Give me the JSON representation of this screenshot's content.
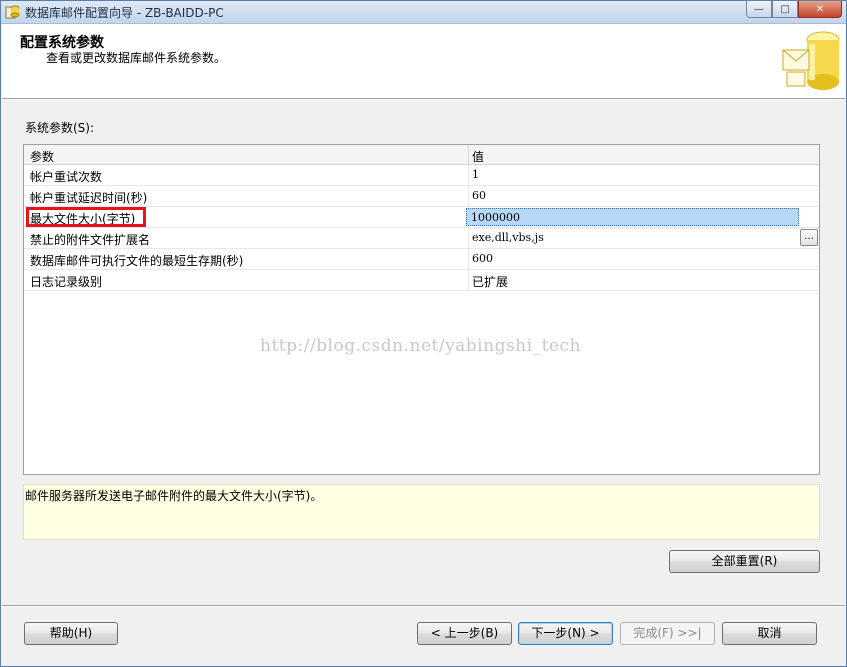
{
  "window": {
    "title": "数据库邮件配置向导 - ZB-BAIDD-PC",
    "min_glyph": "—",
    "max_glyph": "□",
    "close_glyph": "✕"
  },
  "header": {
    "title": "配置系统参数",
    "subtitle": "查看或更改数据库邮件系统参数。"
  },
  "section_label": "系统参数(S):",
  "grid": {
    "col_param": "参数",
    "col_value": "值",
    "rows": [
      {
        "param": "帐户重试次数",
        "value": "1"
      },
      {
        "param": "帐户重试延迟时间(秒)",
        "value": "60"
      },
      {
        "param": "最大文件大小(字节)",
        "value": "1000000"
      },
      {
        "param": "禁止的附件文件扩展名",
        "value": "exe,dll,vbs,js"
      },
      {
        "param": "数据库邮件可执行文件的最短生存期(秒)",
        "value": "600"
      },
      {
        "param": "日志记录级别",
        "value": "已扩展"
      }
    ],
    "ellipsis": "..."
  },
  "watermark": "http://blog.csdn.net/yabingshi_tech",
  "description": "邮件服务器所发送电子邮件附件的最大文件大小(字节)。",
  "buttons": {
    "reset_all": "全部重置(R)",
    "help": "帮助(H)",
    "back": "< 上一步(B)",
    "next": "下一步(N) >",
    "finish": "完成(F) >>|",
    "cancel": "取消"
  }
}
